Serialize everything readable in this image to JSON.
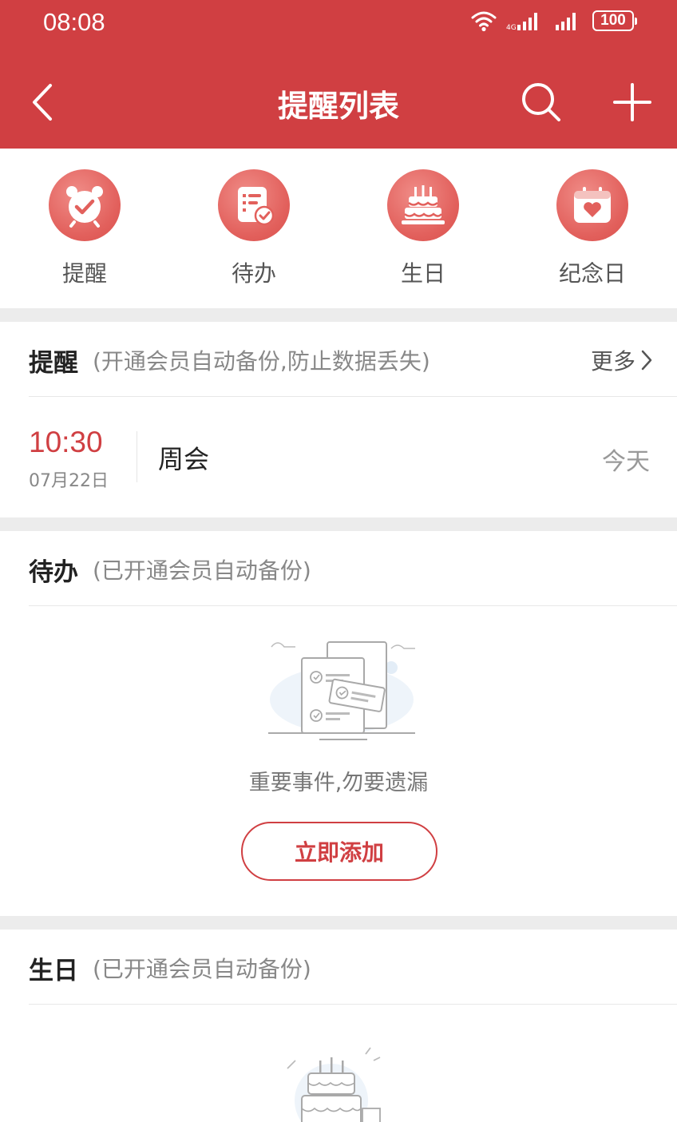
{
  "status_bar": {
    "time": "08:08",
    "battery": "100"
  },
  "nav": {
    "title": "提醒列表"
  },
  "categories": [
    {
      "label": "提醒",
      "icon": "alarm-clock-icon"
    },
    {
      "label": "待办",
      "icon": "todo-list-icon"
    },
    {
      "label": "生日",
      "icon": "birthday-cake-icon"
    },
    {
      "label": "纪念日",
      "icon": "calendar-heart-icon"
    }
  ],
  "reminder_section": {
    "title": "提醒",
    "subtitle": "(开通会员自动备份,防止数据丢失)",
    "more_label": "更多",
    "items": [
      {
        "time": "10:30",
        "date": "07月22日",
        "title": "周会",
        "day": "今天"
      }
    ]
  },
  "todo_section": {
    "title": "待办",
    "subtitle": "(已开通会员自动备份)",
    "empty_text": "重要事件,勿要遗漏",
    "add_label": "立即添加"
  },
  "birthday_section": {
    "title": "生日",
    "subtitle": "(已开通会员自动备份)"
  },
  "colors": {
    "accent": "#d03f42",
    "icon_bg": "#e2605c",
    "separator": "#ececec"
  }
}
